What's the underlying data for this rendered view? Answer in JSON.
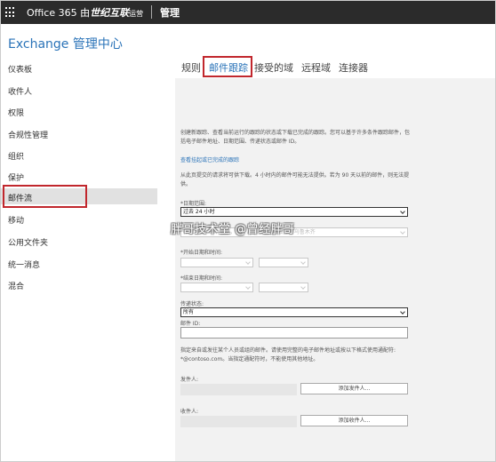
{
  "header": {
    "brand_prefix": "Office 365 由",
    "brand_bold": "世纪互联",
    "brand_suffix": "运营",
    "admin_label": "管理"
  },
  "page_title": "Exchange 管理中心",
  "sidebar": {
    "items": [
      {
        "label": "仪表板"
      },
      {
        "label": "收件人"
      },
      {
        "label": "权限"
      },
      {
        "label": "合规性管理"
      },
      {
        "label": "组织"
      },
      {
        "label": "保护"
      },
      {
        "label": "邮件流"
      },
      {
        "label": "移动"
      },
      {
        "label": "公用文件夹"
      },
      {
        "label": "统一消息"
      },
      {
        "label": "混合"
      }
    ],
    "selected": "邮件流"
  },
  "tabs": [
    {
      "label": "规则"
    },
    {
      "label": "邮件跟踪"
    },
    {
      "label": "接受的域"
    },
    {
      "label": "远程域"
    },
    {
      "label": "连接器"
    }
  ],
  "active_tab": "邮件跟踪",
  "form": {
    "intro": "创建新跟踪、查看当前运行的跟踪的状态或下载已完成的跟踪。您可以基于许多条件跟踪邮件，包括电子邮件地址、日期范围、传递状态或邮件 ID。",
    "view_link": "查看挂起或已完成的跟踪",
    "note": "从此页提交的请求将可供下载。4 小时内的邮件可能无法提供。若为 90 天以前的邮件，则无法提供。",
    "date_range_label": "*日期范围:",
    "date_range_value": "过去 24 小时",
    "timezone_label": "*",
    "timezone_value": "(UTC+08:00) 北京，重庆，香港特别行政区，乌鲁木齐",
    "start_label": "*开始日期和时间:",
    "end_label": "*结束日期和时间:",
    "status_label": "传递状态:",
    "status_value": "所有",
    "message_id_label": "邮件 ID:",
    "hint": "指定来自或发往某个人员或组的邮件。请使用完整的电子邮件地址或按以下格式使用通配符: *@contoso.com。当指定通配符时，不能使用其他地址。",
    "sender_label": "发件人:",
    "add_sender": "添加发件人...",
    "recipient_label": "收件人:",
    "add_recipient": "添加收件人..."
  },
  "watermark": "胖哥技术堂 @曾经胖哥",
  "colors": {
    "accent": "#2a73b8",
    "highlight_box": "#c1272d",
    "topbar": "#2b2b2b"
  }
}
